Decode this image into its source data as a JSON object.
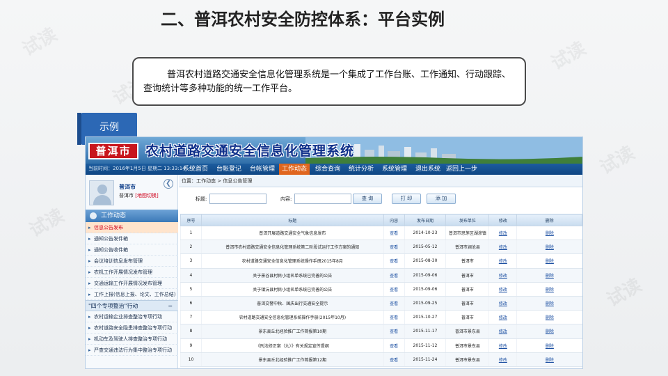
{
  "watermark": "试读",
  "slide": {
    "title": "二、普洱农村安全防控体系：平台实例",
    "description": "普洱农村道路交通安全信息化管理系统是一个集成了工作台账、工作通知、行动跟踪、查询统计等多种功能的统一工作平台。",
    "tag": "示例"
  },
  "app": {
    "logo": "普洱市",
    "title": "农村道路交通安全信息化管理系统",
    "current_time": "当前时间：2016年1月5日 星期二 13:33:14",
    "nav": [
      "系统首页",
      "台帐登记",
      "台帐管理",
      "工作动态",
      "综合查询",
      "统计分析",
      "系统管理",
      "退出系统",
      "返回上一步"
    ],
    "nav_active_index": 3,
    "user": {
      "name": "普洱市",
      "area": "普洱市",
      "switch": "[地图切换]"
    },
    "collapse_icon": "chevron-left-icon",
    "sidebar": {
      "section": "工作动态",
      "items": [
        "信息公告发布",
        "通知公告发件箱",
        "通知公告收件箱",
        "会议培训信息发布管理",
        "农机工作开展情况发布管理",
        "交通运输工作开展情况发布管理",
        "工作上报(信息上报、论文、工作总结)"
      ],
      "group": "\"四个专项整治\"行动",
      "group_toggle": "−",
      "group_items": [
        "农村运输企业排查整治专项行动",
        "农村道路安全隐患排查整治专项行动",
        "机动车及驾驶人排查整治专项行动",
        "严查交通违法行为集中整治专项行动"
      ]
    },
    "breadcrumb": "位置：工作动态 > 信息公告管理",
    "search": {
      "title_label": "标题:",
      "content_label": "内容:",
      "title_value": "",
      "content_value": "",
      "query_btn": "查 询",
      "print_btn": "打 印",
      "add_btn": "添 加"
    },
    "table": {
      "headers": [
        "序号",
        "标题",
        "内容",
        "发布日期",
        "发布单位",
        "修改",
        "删除"
      ],
      "rows": [
        [
          "1",
          "普洱开展道路交通安全气象信息发布",
          "查看",
          "2014-10-23",
          "普洱市思茅区湖渗镇",
          "修改",
          "删除"
        ],
        [
          "2",
          "普洱市农村道路交通安全信息化管理系统第二阶段试运行工作方案的通知",
          "查看",
          "2015-05-12",
          "普洱市澜沧县",
          "修改",
          "删除"
        ],
        [
          "3",
          "农村道路交通安全信息化管理系统操作手册2015年8月",
          "查看",
          "2015-08-30",
          "普洱市",
          "修改",
          "删除"
        ],
        [
          "4",
          "关于景谷县村民小组名单系统已完善的公告",
          "查看",
          "2015-09-06",
          "普洱市",
          "修改",
          "删除"
        ],
        [
          "5",
          "关于镇沅县村民小组名单系统已完善的公告",
          "查看",
          "2015-09-06",
          "普洱市",
          "修改",
          "删除"
        ],
        [
          "6",
          "普洱交警中秋、国庆出行交通安全提示",
          "查看",
          "2015-09-25",
          "普洱市",
          "修改",
          "删除"
        ],
        [
          "7",
          "农村道路交通安全信息化管理系统操作手册(2015年10月)",
          "查看",
          "2015-10-27",
          "普洱市",
          "修改",
          "删除"
        ],
        [
          "8",
          "景东县丘北经验推广工作简报第10期",
          "查看",
          "2015-11-17",
          "普洱市景东县",
          "修改",
          "删除"
        ],
        [
          "9",
          "《刑法修正案（九）》有关规定宣传提纲",
          "查看",
          "2015-11-12",
          "普洱市景东县",
          "修改",
          "删除"
        ],
        [
          "10",
          "景东县丘北经验推广工作简报第12期",
          "查看",
          "2015-11-24",
          "普洱市景东县",
          "修改",
          "删除"
        ]
      ]
    }
  }
}
